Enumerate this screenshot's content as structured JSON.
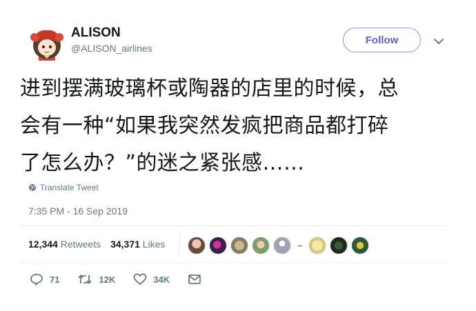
{
  "user": {
    "display_name": "ALISON",
    "handle": "@ALISON_airlines",
    "avatar_icon": "anime-girl-avatar"
  },
  "follow_label": "Follow",
  "tweet": {
    "lines": [
      "进到摆满玻璃杯或陶器的店里的时候，总",
      "会有一种“如果我突然发疯把商品都打碎",
      "了怎么办？”的迷之紧张感……"
    ]
  },
  "translate_label": "Translate Tweet",
  "timestamp": "7:35 PM - 16 Sep 2019",
  "stats": {
    "retweets_count": "12,344",
    "retweets_label": "Retweets",
    "likes_count": "34,371",
    "likes_label": "Likes"
  },
  "likers_tilde": "~",
  "actions": {
    "replies": "71",
    "retweets": "12K",
    "likes": "34K"
  },
  "colors": {
    "accent": "#5b61d6",
    "muted": "#657786",
    "text": "#14171a",
    "divider": "#e6ecf0"
  }
}
